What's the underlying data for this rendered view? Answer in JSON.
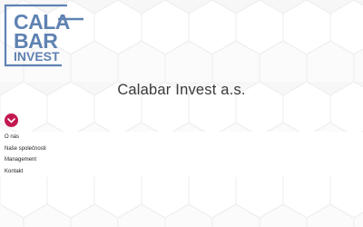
{
  "logo": {
    "line1": "CALA",
    "line2": "BAR",
    "line3": "INVEST",
    "color": "#5f82b2"
  },
  "title": "Calabar Invest a.s.",
  "menu_toggle": {
    "icon": "chevron-down-icon",
    "color": "#c2184f"
  },
  "menu": {
    "items": [
      {
        "label": "O nás"
      },
      {
        "label": "Naše společnosti"
      },
      {
        "label": "Management"
      },
      {
        "label": "Kontakt"
      }
    ]
  }
}
